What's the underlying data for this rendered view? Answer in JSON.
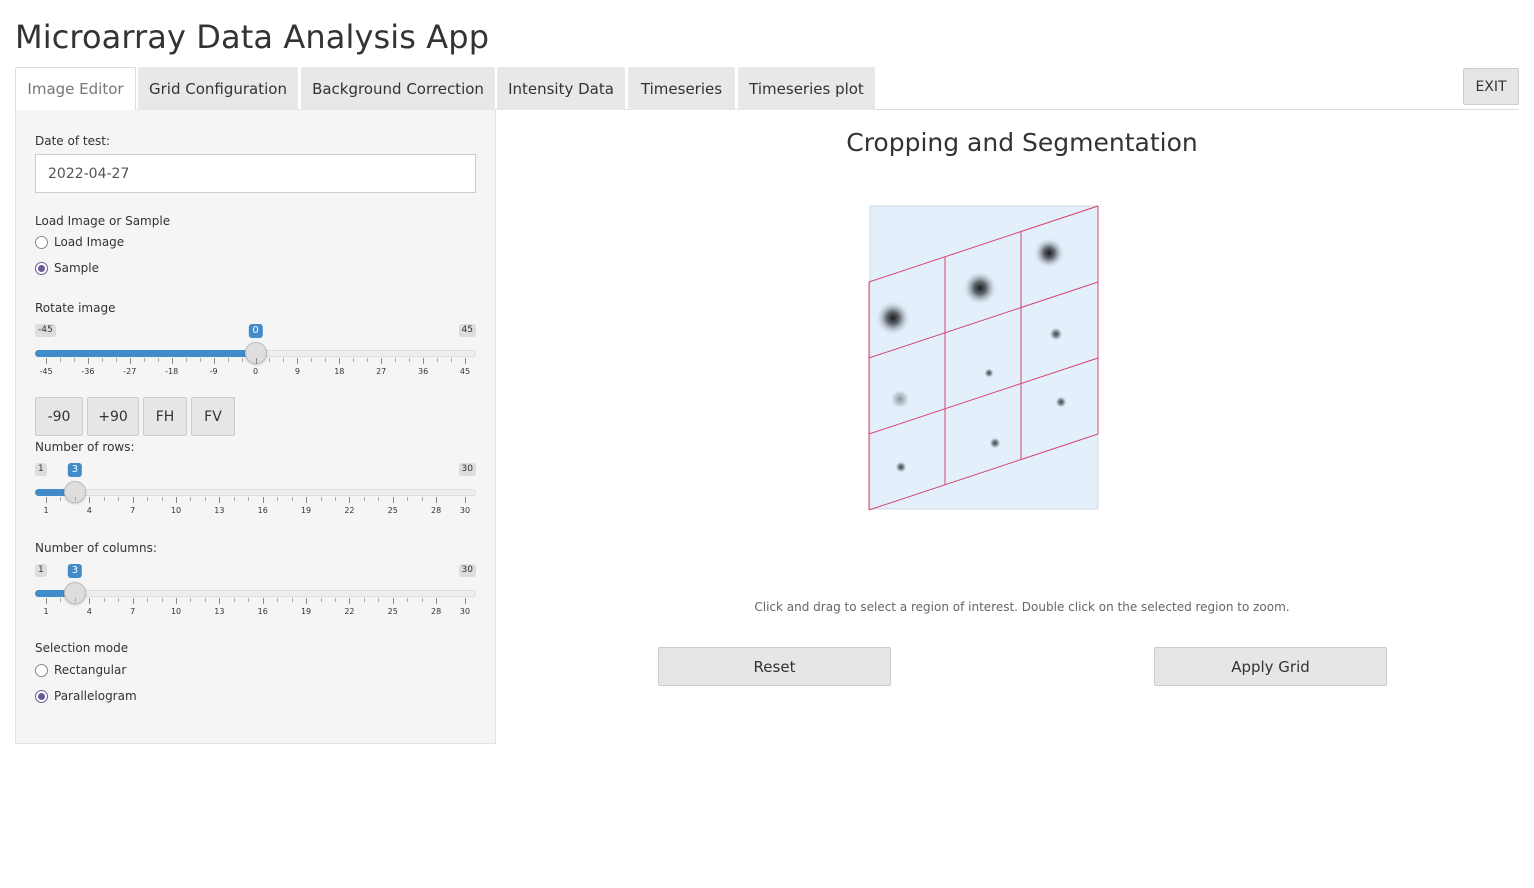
{
  "app": {
    "title": "Microarray Data Analysis App"
  },
  "tabs": [
    {
      "label": "Image Editor",
      "active": true
    },
    {
      "label": "Grid Configuration",
      "active": false
    },
    {
      "label": "Background Correction",
      "active": false
    },
    {
      "label": "Intensity Data",
      "active": false
    },
    {
      "label": "Timeseries",
      "active": false
    },
    {
      "label": "Timeseries plot",
      "active": false
    }
  ],
  "exit_label": "EXIT",
  "sidebar": {
    "date_label": "Date of test:",
    "date_value": "2022-04-27",
    "load_label": "Load Image or Sample",
    "load_options": [
      {
        "label": "Load Image",
        "checked": false
      },
      {
        "label": "Sample",
        "checked": true
      }
    ],
    "rotate": {
      "label": "Rotate image",
      "min": "-45",
      "max": "45",
      "value": "0",
      "tick_labels": [
        "-45",
        "-36",
        "-27",
        "-18",
        "-9",
        "0",
        "9",
        "18",
        "27",
        "36",
        "45"
      ]
    },
    "rotate_buttons": [
      "-90",
      "+90",
      "FH",
      "FV"
    ],
    "rows": {
      "label": "Number of rows:",
      "min": "1",
      "max": "30",
      "value": "3",
      "tick_labels": [
        "1",
        "4",
        "7",
        "10",
        "13",
        "16",
        "19",
        "22",
        "25",
        "28",
        "30"
      ]
    },
    "cols": {
      "label": "Number of columns:",
      "min": "1",
      "max": "30",
      "value": "3",
      "tick_labels": [
        "1",
        "4",
        "7",
        "10",
        "13",
        "16",
        "19",
        "22",
        "25",
        "28",
        "30"
      ]
    },
    "selection_label": "Selection mode",
    "selection_options": [
      {
        "label": "Rectangular",
        "checked": false
      },
      {
        "label": "Parallelogram",
        "checked": true
      }
    ]
  },
  "main": {
    "title": "Cropping and Segmentation",
    "hint": "Click and drag to select a region of interest. Double click on the selected region to zoom.",
    "reset_label": "Reset",
    "apply_label": "Apply Grid"
  },
  "colors": {
    "accent": "#428bca",
    "radio": "#6b5b95",
    "grid_line": "#d6456b",
    "image_bg": "#e3f0fc"
  }
}
